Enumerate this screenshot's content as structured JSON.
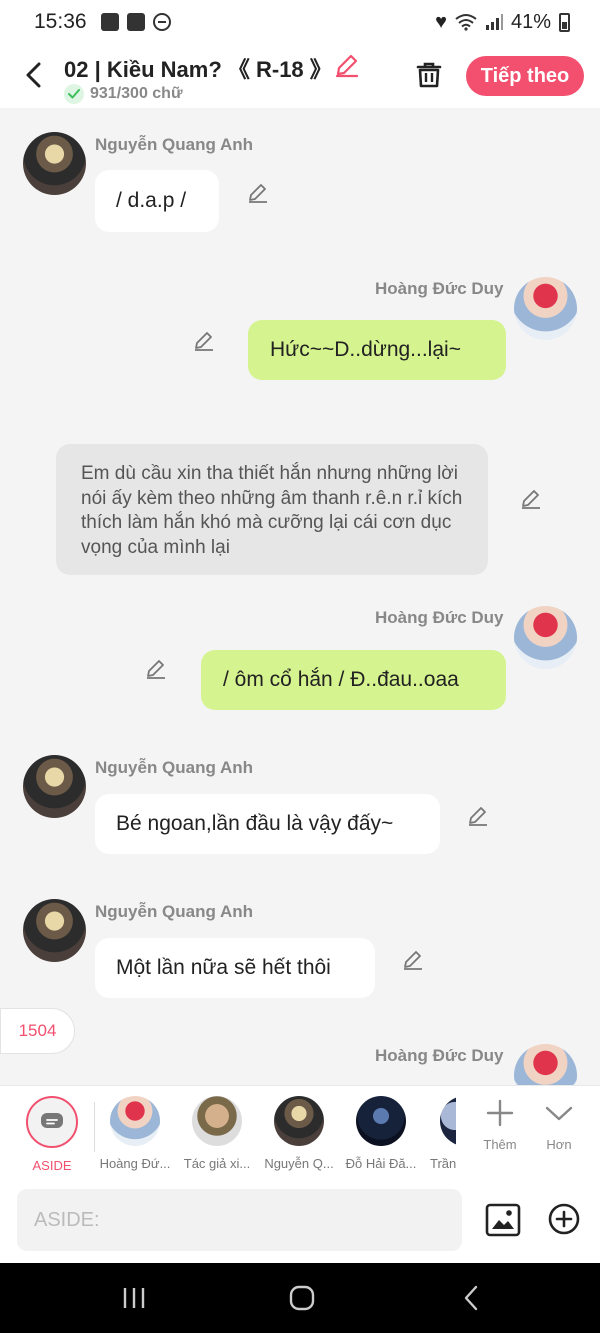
{
  "status": {
    "time": "15:36",
    "battery": "41%"
  },
  "header": {
    "title": "02 | Kiều Nam? 《 R-18 》",
    "word_count": "931/300 chữ",
    "next_label": "Tiếp theo"
  },
  "messages": [
    {
      "speaker": "Nguyễn Quang Anh",
      "text": "/ d.a.p /"
    },
    {
      "speaker": "Hoàng Đức Duy",
      "text": "Hức~~D..dừng...lại~"
    },
    {
      "narration": "Em dù cầu xin tha thiết hắn nhưng những lời nói ấy kèm theo những âm thanh r.ê.n r.ỉ kích thích làm hắn khó mà cưỡng lại cái cơn dục vọng của mình lại"
    },
    {
      "speaker": "Hoàng Đức Duy",
      "text": "/ ôm cổ hắn / Đ..đau..oaa"
    },
    {
      "speaker": "Nguyễn Quang Anh",
      "text": "Bé ngoan,lần đầu là vậy đấy~"
    },
    {
      "speaker": "Nguyễn Quang Anh",
      "text": "Một lần nữa sẽ hết thôi"
    },
    {
      "speaker": "Hoàng Đức Duy"
    }
  ],
  "float_counter": "1504",
  "characters": [
    {
      "label": "ASIDE",
      "icon": "chat-bubble-icon"
    },
    {
      "label": "Hoàng Đứ..."
    },
    {
      "label": "Tác giả xi..."
    },
    {
      "label": "Nguyễn Q..."
    },
    {
      "label": "Đỗ Hải Đă..."
    },
    {
      "label": "Trần"
    }
  ],
  "tools": {
    "add_label": "Thêm",
    "more_label": "Hơn"
  },
  "input": {
    "placeholder": "ASIDE:"
  },
  "colors": {
    "accent": "#f2506e",
    "own_bubble": "#d5f38e",
    "other_bubble": "#ffffff",
    "narration_bg": "#e6e6e6"
  }
}
